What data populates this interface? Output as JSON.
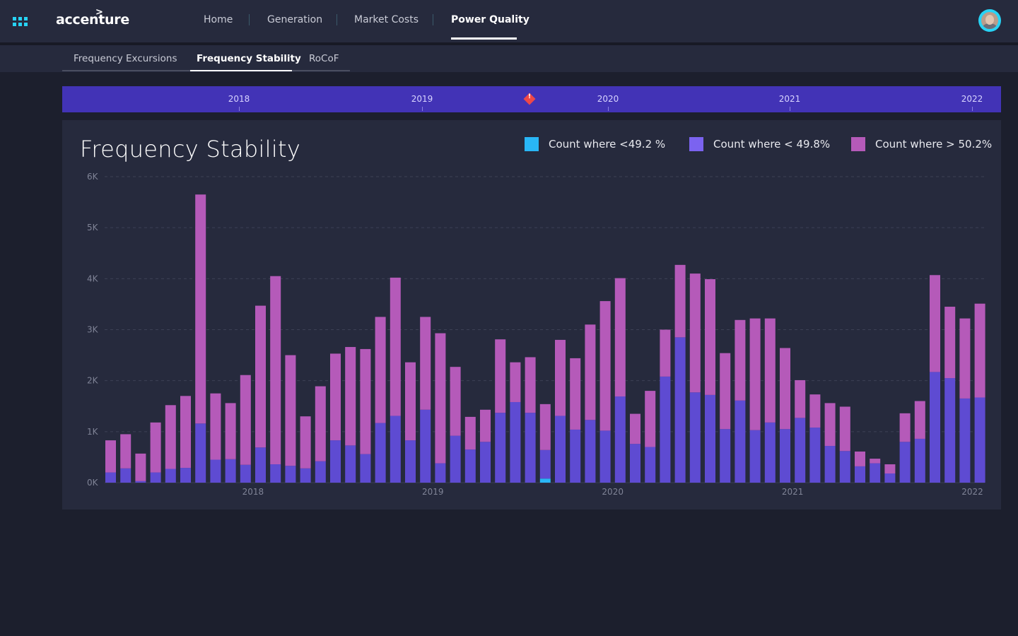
{
  "app": {
    "brand": "accenture",
    "brand_mark": ">"
  },
  "nav": {
    "items": [
      {
        "label": "Home"
      },
      {
        "label": "Generation"
      },
      {
        "label": "Market Costs"
      },
      {
        "label": "Power Quality"
      }
    ],
    "active": "Power Quality"
  },
  "subtabs": {
    "items": [
      {
        "label": "Frequency Excursions"
      },
      {
        "label": "Frequency Stability"
      },
      {
        "label": "RoCoF"
      }
    ],
    "active": "Frequency Stability"
  },
  "timeline": {
    "labels": [
      "2018",
      "2019",
      "2020",
      "2021",
      "2022"
    ],
    "marker_symbol": "!",
    "marker_color": "#ef4848"
  },
  "colors": {
    "series_49_2": "#29b6f6",
    "series_49_8": "#5e4bd2",
    "series_50_2": "#b55ab9",
    "legend_49_8": "#7b63f0"
  },
  "chart_data": {
    "type": "bar",
    "stacked": true,
    "title": "Frequency Stability",
    "xlabel": "",
    "ylabel": "",
    "ylim": [
      0,
      6000
    ],
    "y_ticks": [
      "0K",
      "1K",
      "2K",
      "3K",
      "4K",
      "5K",
      "6K"
    ],
    "x_ticks": [
      "2018",
      "2019",
      "2020",
      "2021",
      "2022"
    ],
    "legend_position": "top-right",
    "grid": true,
    "categories": [
      "2017-03",
      "2017-04",
      "2017-05",
      "2017-06",
      "2017-07",
      "2017-08",
      "2017-09",
      "2017-10",
      "2017-11",
      "2017-12",
      "2018-01",
      "2018-02",
      "2018-03",
      "2018-04",
      "2018-05",
      "2018-06",
      "2018-07",
      "2018-08",
      "2018-09",
      "2018-10",
      "2018-11",
      "2018-12",
      "2019-01",
      "2019-02",
      "2019-03",
      "2019-04",
      "2019-05",
      "2019-06",
      "2019-07",
      "2019-08",
      "2019-09",
      "2019-10",
      "2019-11",
      "2019-12",
      "2020-01",
      "2020-02",
      "2020-03",
      "2020-04",
      "2020-05",
      "2020-06",
      "2020-07",
      "2020-08",
      "2020-09",
      "2020-10",
      "2020-11",
      "2020-12",
      "2021-01",
      "2021-02",
      "2021-03",
      "2021-04",
      "2021-05",
      "2021-06",
      "2021-07",
      "2021-08",
      "2021-09",
      "2021-10",
      "2021-11",
      "2021-12",
      "2022-01",
      "2022-02",
      "2022-03",
      "2022-04"
    ],
    "series": [
      {
        "name": "Count where <49.2 %",
        "values": [
          0,
          0,
          0,
          0,
          0,
          0,
          0,
          0,
          0,
          0,
          0,
          0,
          0,
          0,
          0,
          0,
          0,
          0,
          0,
          0,
          0,
          0,
          0,
          0,
          0,
          0,
          0,
          0,
          0,
          80,
          0,
          0,
          0,
          0,
          0,
          0,
          0,
          0,
          0,
          0,
          0,
          0,
          0,
          0,
          0,
          0,
          0,
          0,
          0,
          0,
          0,
          0,
          0,
          0,
          0,
          0,
          0,
          0,
          0,
          0,
          0,
          0
        ]
      },
      {
        "name": "Count where < 49.8%",
        "values": [
          200,
          280,
          30,
          200,
          270,
          290,
          1160,
          450,
          460,
          350,
          690,
          360,
          330,
          280,
          420,
          830,
          730,
          560,
          1170,
          1310,
          830,
          1430,
          380,
          920,
          650,
          800,
          1370,
          1580,
          1370,
          560,
          1310,
          1040,
          1230,
          1020,
          1690,
          760,
          700,
          2080,
          2850,
          1770,
          1720,
          1050,
          1610,
          1030,
          1180,
          1050,
          1270,
          1080,
          720,
          620,
          320,
          380,
          180,
          800,
          860,
          2170,
          2050,
          1650,
          1670,
          0,
          0,
          0
        ]
      },
      {
        "name": "Count where > 50.2%",
        "values": [
          630,
          670,
          540,
          980,
          1250,
          1410,
          4490,
          1300,
          1100,
          1760,
          2780,
          3690,
          2170,
          1020,
          1470,
          1700,
          1930,
          2060,
          2080,
          2710,
          1530,
          1820,
          2550,
          1350,
          640,
          630,
          1440,
          780,
          1090,
          900,
          1490,
          1400,
          1870,
          2540,
          2320,
          590,
          1100,
          920,
          1420,
          2330,
          2270,
          1490,
          1580,
          2190,
          2040,
          1590,
          740,
          650,
          840,
          870,
          290,
          90,
          180,
          560,
          740,
          1900,
          1400,
          1570,
          1840,
          0,
          0,
          0
        ]
      }
    ]
  }
}
